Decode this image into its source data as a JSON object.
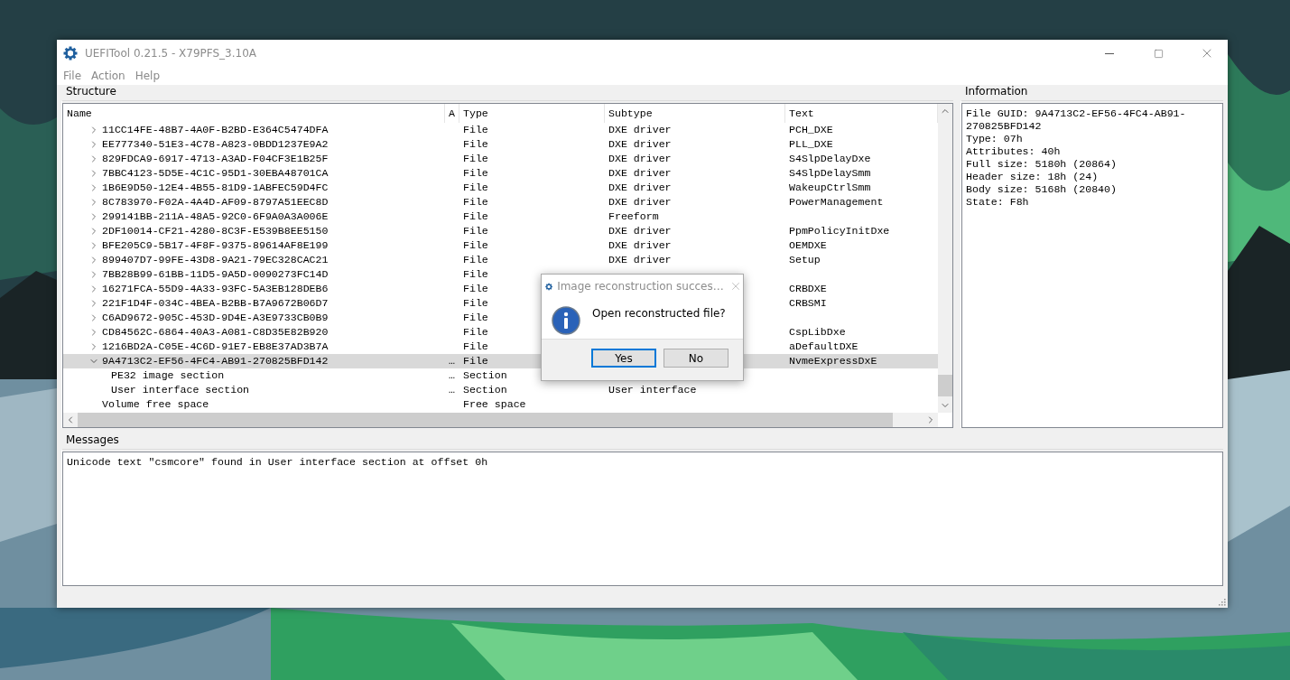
{
  "window": {
    "title": "UEFITool 0.21.5 - X79PFS_3.10A"
  },
  "menu": [
    "File",
    "Action",
    "Help"
  ],
  "structure": {
    "label": "Structure",
    "columns": [
      "Name",
      "A",
      "Type",
      "Subtype",
      "Text"
    ],
    "rows": [
      {
        "name": "11CC14FE-48B7-4A0F-B2BD-E364C5474DFA",
        "type": "File",
        "subtype": "DXE driver",
        "text": "PCH_DXE",
        "expanded": false,
        "selected": false
      },
      {
        "name": "EE777340-51E3-4C78-A823-0BDD1237E9A2",
        "type": "File",
        "subtype": "DXE driver",
        "text": "PLL_DXE",
        "expanded": false,
        "selected": false
      },
      {
        "name": "829FDCA9-6917-4713-A3AD-F04CF3E1B25F",
        "type": "File",
        "subtype": "DXE driver",
        "text": "S4SlpDelayDxe",
        "expanded": false,
        "selected": false
      },
      {
        "name": "7BBC4123-5D5E-4C1C-95D1-30EBA48701CA",
        "type": "File",
        "subtype": "DXE driver",
        "text": "S4SlpDelaySmm",
        "expanded": false,
        "selected": false
      },
      {
        "name": "1B6E9D50-12E4-4B55-81D9-1ABFEC59D4FC",
        "type": "File",
        "subtype": "DXE driver",
        "text": "WakeupCtrlSmm",
        "expanded": false,
        "selected": false
      },
      {
        "name": "8C783970-F02A-4A4D-AF09-8797A51EEC8D",
        "type": "File",
        "subtype": "DXE driver",
        "text": "PowerManagement",
        "expanded": false,
        "selected": false
      },
      {
        "name": "299141BB-211A-48A5-92C0-6F9A0A3A006E",
        "type": "File",
        "subtype": "Freeform",
        "expanded": false,
        "selected": false
      },
      {
        "name": "2DF10014-CF21-4280-8C3F-E539B8EE5150",
        "type": "File",
        "subtype": "DXE driver",
        "text": "PpmPolicyInitDxe",
        "expanded": false,
        "selected": false
      },
      {
        "name": "BFE205C9-5B17-4F8F-9375-89614AF8E199",
        "type": "File",
        "subtype": "DXE driver",
        "text": "OEMDXE",
        "expanded": false,
        "selected": false
      },
      {
        "name": "899407D7-99FE-43D8-9A21-79EC328CAC21",
        "type": "File",
        "subtype": "DXE driver",
        "text": "Setup",
        "expanded": false,
        "selected": false
      },
      {
        "name": "7BB28B99-61BB-11D5-9A5D-0090273FC14D",
        "type": "File",
        "expanded": false,
        "selected": false
      },
      {
        "name": "16271FCA-55D9-4A33-93FC-5A3EB128DEB6",
        "type": "File",
        "text": "CRBDXE",
        "expanded": false,
        "selected": false
      },
      {
        "name": "221F1D4F-034C-4BEA-B2BB-B7A9672B06D7",
        "type": "File",
        "text": "CRBSMI",
        "expanded": false,
        "selected": false
      },
      {
        "name": "C6AD9672-905C-453D-9D4E-A3E9733CB0B9",
        "type": "File",
        "expanded": false,
        "selected": false
      },
      {
        "name": "CD84562C-6864-40A3-A081-C8D35E82B920",
        "type": "File",
        "text": "CspLibDxe",
        "expanded": false,
        "selected": false
      },
      {
        "name": "1216BD2A-C05E-4C6D-91E7-EB8E37AD3B7A",
        "type": "File",
        "text": "aDefaultDXE",
        "expanded": false,
        "selected": false
      },
      {
        "name": "9A4713C2-EF56-4FC4-AB91-270825BFD142",
        "action": "…",
        "type": "File",
        "text": "NvmeExpressDxE",
        "expanded": true,
        "selected": true,
        "children": [
          {
            "name": "PE32 image section",
            "action": "…",
            "type": "Section",
            "selected": false
          },
          {
            "name": "User interface section",
            "action": "…",
            "type": "Section",
            "subtype": "User interface",
            "selected": false
          }
        ]
      },
      {
        "name": "Volume free space",
        "type": "Free space",
        "selected": false
      }
    ]
  },
  "information": {
    "label": "Information",
    "lines": [
      "File GUID: 9A4713C2-EF56-4FC4-AB91-270825BFD142",
      "Type: 07h",
      "Attributes: 40h",
      "Full size: 5180h (20864)",
      "Header size: 18h (24)",
      "Body size: 5168h (20840)",
      "State: F8h"
    ]
  },
  "messages": {
    "label": "Messages",
    "lines": [
      "Unicode text \"csmcore\" found in User interface section at offset 0h"
    ]
  },
  "dialog": {
    "title": "Image reconstruction succes…",
    "message": "Open reconstructed file?",
    "buttons": [
      {
        "label": "Yes",
        "focused": true
      },
      {
        "label": "No",
        "focused": false
      }
    ]
  }
}
